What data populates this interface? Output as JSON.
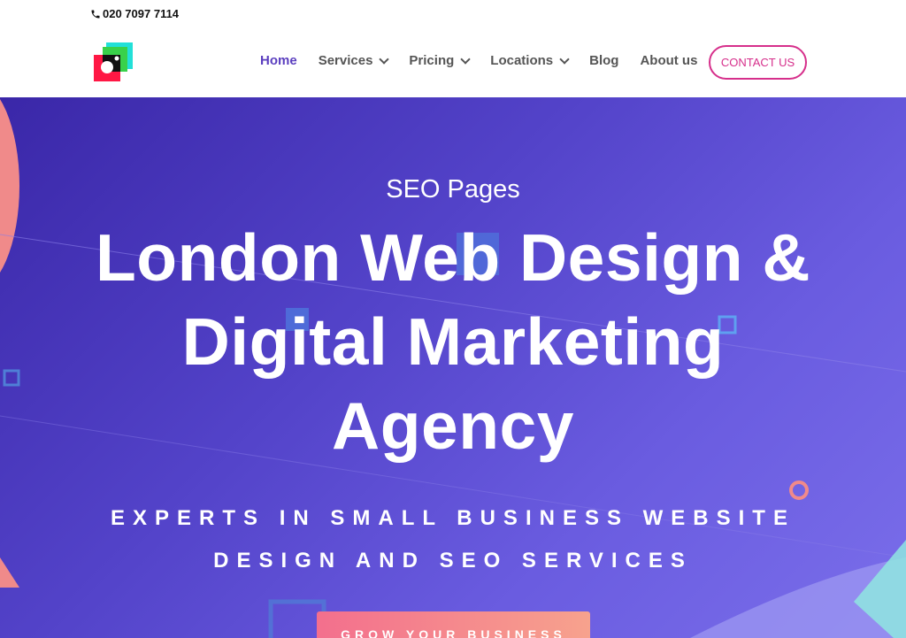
{
  "topbar": {
    "phone": "020 7097 7114",
    "icon": "phone-icon"
  },
  "header": {
    "logo_icon": "brand-logo",
    "nav": [
      {
        "label": "Home",
        "active": true,
        "has_dropdown": false
      },
      {
        "label": "Services",
        "active": false,
        "has_dropdown": true
      },
      {
        "label": "Pricing",
        "active": false,
        "has_dropdown": true
      },
      {
        "label": "Locations",
        "active": false,
        "has_dropdown": true
      },
      {
        "label": "Blog",
        "active": false,
        "has_dropdown": false
      },
      {
        "label": "About us",
        "active": false,
        "has_dropdown": false
      }
    ],
    "contact_label": "CONTACT US"
  },
  "hero": {
    "eyebrow": "SEO Pages",
    "headline_line1": "London Web Design &",
    "headline_line2": "Digital Marketing",
    "headline_line3": "Agency",
    "subhead_line1": "EXPERTS IN SMALL BUSINESS WEBSITE",
    "subhead_line2": "DESIGN AND SEO SERVICES",
    "cta_label": "GROW YOUR BUSINESS"
  },
  "colors": {
    "accent": "#5b3fbf",
    "contact": "#d62f8b",
    "hero_start": "#3a27a8",
    "hero_end": "#7a6eea",
    "cta_start": "#f36f8d",
    "cta_end": "#f7a28d"
  }
}
